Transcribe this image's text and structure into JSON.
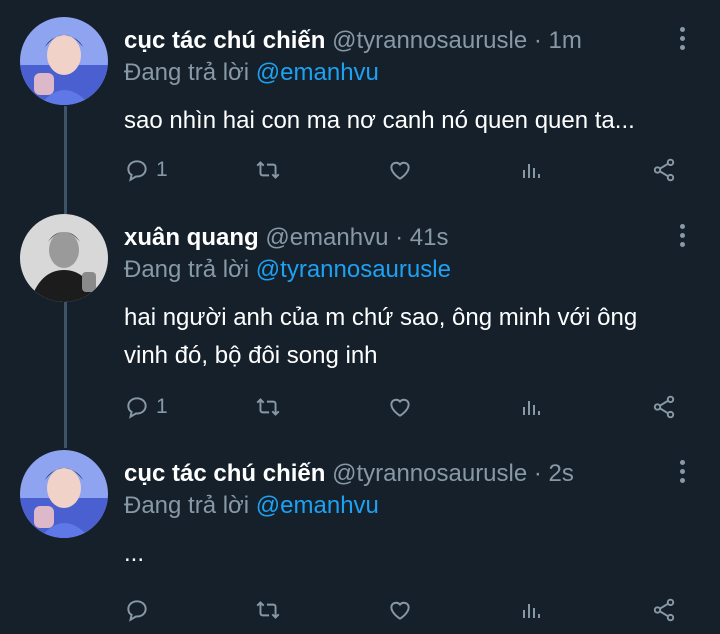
{
  "tweets": [
    {
      "name": "cục tác chú chiến",
      "handle": "@tyrannosaurusle",
      "time": "· 1m",
      "reply_prefix": "Đang trả lời",
      "reply_to": "@emanhvu",
      "text": "sao nhìn hai con ma nơ canh nó quen quen ta...",
      "reply_count": "1",
      "avatar": "avatar-blue-portrait"
    },
    {
      "name": "xuân quang",
      "handle": "@emanhvu",
      "time": "· 41s",
      "reply_prefix": "Đang trả lời",
      "reply_to": "@tyrannosaurusle",
      "text_line1": "hai người anh của m chứ sao, ông minh với ông",
      "text_line2": "vinh đó, bộ đôi song inh",
      "reply_count": "1",
      "avatar": "avatar-bw-portrait"
    },
    {
      "name": "cục tác chú chiến",
      "handle": "@tyrannosaurusle",
      "time": "· 2s",
      "reply_prefix": "Đang trả lời",
      "reply_to": "@emanhvu",
      "text": "...",
      "reply_count": "",
      "avatar": "avatar-blue-portrait"
    }
  ],
  "icons": [
    "reply-icon",
    "retweet-icon",
    "like-icon",
    "analytics-icon",
    "share-icon",
    "more-icon"
  ],
  "colors": {
    "background": "#15202b",
    "muted": "#8899a6",
    "link": "#1da1f2",
    "text": "#ffffff"
  }
}
